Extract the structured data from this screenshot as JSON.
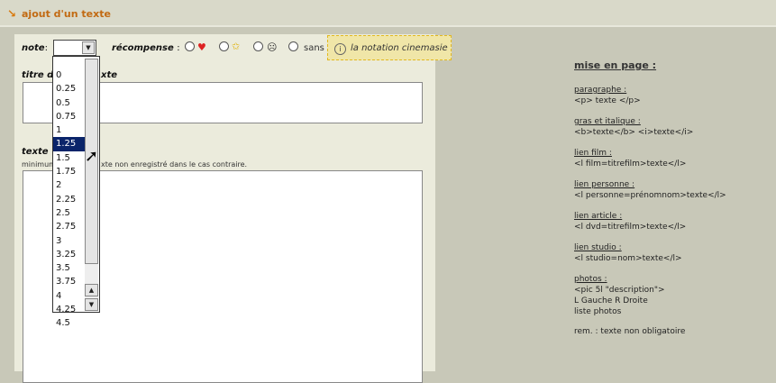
{
  "header": {
    "title": "ajout d'un texte",
    "icon": "arrow-icon"
  },
  "form": {
    "note_label": "note",
    "note_colon": ":",
    "recompense_label": "récompense",
    "recompense_colon": ":",
    "sans_label": "sans",
    "badge_text": "la notation cinemasie",
    "titre_label_left": "titre d",
    "titre_label_right": "xte",
    "texte_label": "texte",
    "hint_left": "minimum",
    "hint_right": "xte non enregistré dans le cas contraire."
  },
  "dropdown": {
    "selected": "1.25",
    "options": [
      "0",
      "0.25",
      "0.5",
      "0.75",
      "1",
      "1.25",
      "1.5",
      "1.75",
      "2",
      "2.25",
      "2.5",
      "2.75",
      "3",
      "3.25",
      "3.5",
      "3.75",
      "4",
      "4.25",
      "4.5"
    ]
  },
  "help": {
    "title": "mise en page :",
    "sections": [
      {
        "title": "paragraphe :",
        "lines": [
          "<p> texte </p>"
        ]
      },
      {
        "title": "gras et italique :",
        "lines": [
          "<b>texte</b> <i>texte</i>"
        ]
      },
      {
        "title": "lien film :",
        "lines": [
          "<l film=titrefilm>texte</l>"
        ]
      },
      {
        "title": "lien personne :",
        "lines": [
          "<l personne=prénomnom>texte</l>"
        ]
      },
      {
        "title": "lien article :",
        "lines": [
          "<l dvd=titrefilm>texte</l>"
        ]
      },
      {
        "title": "lien studio :",
        "lines": [
          "<l studio=nom>texte</l>"
        ]
      },
      {
        "title": "photos :",
        "lines": [
          "<pic 5l \"description\">",
          "L Gauche R Droite",
          "liste photos"
        ]
      }
    ],
    "footer": "rem. : texte non obligatoire"
  }
}
